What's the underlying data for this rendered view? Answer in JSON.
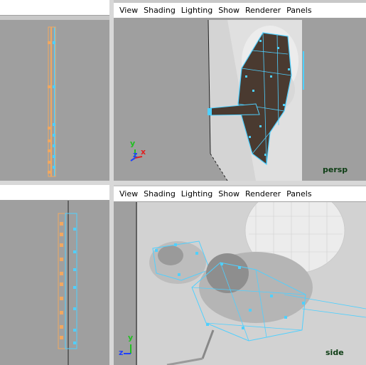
{
  "panels": {
    "persp": {
      "menu": [
        "View",
        "Shading",
        "Lighting",
        "Show",
        "Renderer",
        "Panels"
      ],
      "camera_label": "persp",
      "axes": {
        "y": "y",
        "z": "z",
        "x": "x"
      }
    },
    "side": {
      "menu": [
        "View",
        "Shading",
        "Lighting",
        "Show",
        "Renderer",
        "Panels"
      ],
      "camera_label": "side",
      "axes": {
        "y": "y",
        "z": "z"
      }
    }
  },
  "colors": {
    "viewport_bg": "#9f9f9f",
    "menubar_bg": "#ffffff",
    "wire_cyan": "#4fd0ff",
    "wire_orange": "#f0a860",
    "cam_label": "#0d3d14",
    "axis_x": "#e02020",
    "axis_y": "#20c020",
    "axis_z": "#2040ff"
  }
}
